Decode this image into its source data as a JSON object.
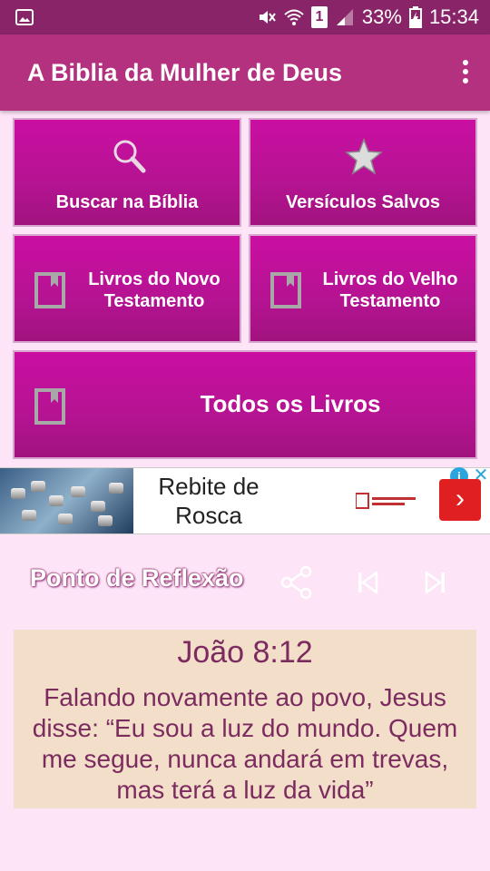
{
  "status_bar": {
    "battery_percent": "33%",
    "time": "15:34",
    "sim_label": "1",
    "icons": [
      "image-icon",
      "mute-icon",
      "wifi-icon",
      "sim-icon",
      "signal-icon",
      "battery-icon"
    ]
  },
  "app_bar": {
    "title": "A Biblia da Mulher de Deus",
    "menu_icon": "overflow-menu-icon"
  },
  "tiles": {
    "search": {
      "label": "Buscar na Bíblia",
      "icon": "search-icon"
    },
    "saved": {
      "label": "Versículos Salvos",
      "icon": "star-icon"
    },
    "new_testament": {
      "label_line1": "Livros do Novo",
      "label_line2": "Testamento",
      "icon": "book-icon"
    },
    "old_testament": {
      "label_line1": "Livros do Velho",
      "label_line2": "Testamento",
      "icon": "book-icon"
    },
    "all_books": {
      "label": "Todos os Livros",
      "icon": "book-icon"
    }
  },
  "ad": {
    "line1": "Rebite de",
    "line2": "Rosca",
    "arrow": "›",
    "info": "i",
    "close": "✕"
  },
  "reflection": {
    "title": "Ponto de Reflexão",
    "icons": [
      "share-icon",
      "skip-previous-icon",
      "skip-next-icon"
    ]
  },
  "verse": {
    "reference": "João 8:12",
    "lines": [
      "Falando novamente ao povo, Jesus",
      "disse: “Eu sou a luz do mundo. Quem",
      "me segue, nunca andará em trevas,",
      "mas terá a luz da vida”"
    ]
  },
  "colors": {
    "status_bar": "#8a2468",
    "app_bar": "#b4317f",
    "tile": "#c0119a",
    "background": "#fde4f6",
    "verse_card": "#f2dec9",
    "verse_text": "#7c2b5f"
  }
}
